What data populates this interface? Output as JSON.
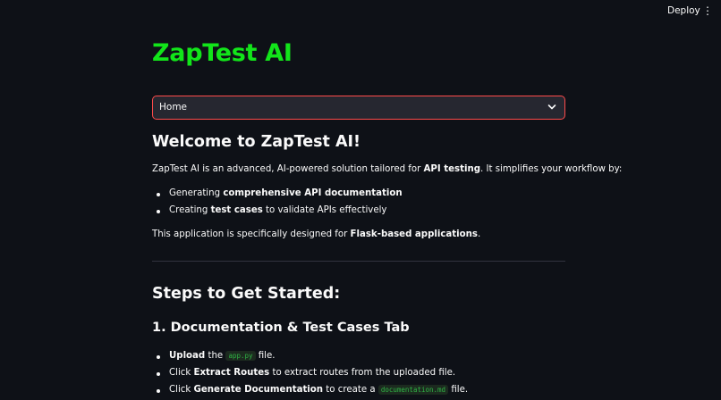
{
  "header": {
    "deploy_label": "Deploy",
    "menu_icon": "kebab-menu-icon"
  },
  "app": {
    "title": "ZapTest AI",
    "title_color": "#12e51a"
  },
  "nav_select": {
    "value": "Home",
    "icon": "chevron-down-icon",
    "border_color": "#ff4b4b"
  },
  "welcome": {
    "heading": "Welcome to ZapTest AI!",
    "intro_pre": "ZapTest AI is an advanced, AI-powered solution tailored for ",
    "intro_bold": "API testing",
    "intro_post": ". It simplifies your workflow by:",
    "bullets": [
      {
        "pre": "Generating ",
        "bold": "comprehensive API documentation",
        "post": ""
      },
      {
        "pre": "Creating ",
        "bold": "test cases",
        "post": " to validate APIs effectively"
      }
    ],
    "designed_pre": "This application is specifically designed for ",
    "designed_bold": "Flask-based applications",
    "designed_post": "."
  },
  "steps": {
    "heading": "Steps to Get Started:",
    "section1_heading": "1. Documentation & Test Cases Tab",
    "items": [
      {
        "bold": "Upload",
        "mid": " the ",
        "code": "app.py",
        "post": " file."
      },
      {
        "pre": "Click ",
        "bold": "Extract Routes",
        "post": " to extract routes from the uploaded file."
      },
      {
        "pre": "Click ",
        "bold": "Generate Documentation",
        "mid": " to create a ",
        "code": "documentation.md",
        "post": " file."
      }
    ]
  }
}
